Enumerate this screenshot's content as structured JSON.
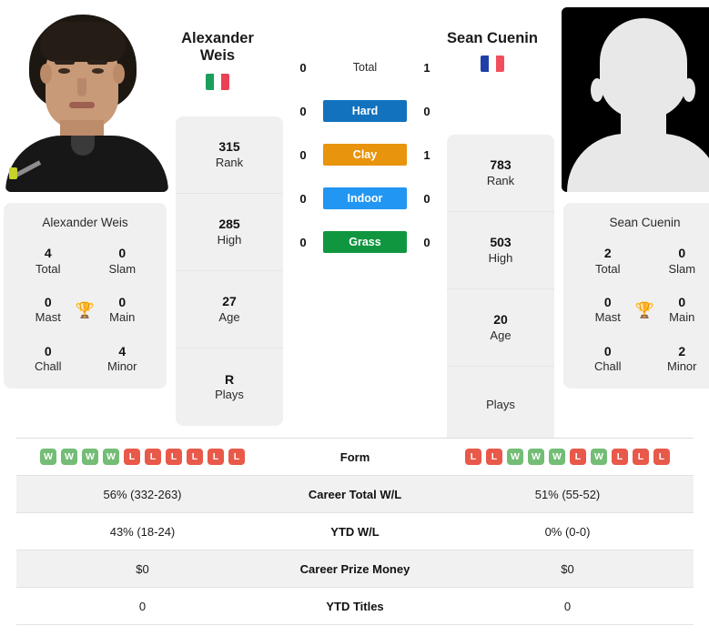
{
  "players": {
    "left": {
      "name": "Alexander Weis",
      "display_name_line1": "Alexander",
      "display_name_line2": "Weis",
      "country": "Italy",
      "flag_colors": [
        "#1aa05a",
        "#ffffff",
        "#ea4156"
      ],
      "photo_type": "portrait-photo",
      "titles": [
        {
          "value": "4",
          "label": "Total"
        },
        {
          "value": "0",
          "label": "Slam"
        },
        {
          "value": "0",
          "label": "Mast"
        },
        {
          "value": "0",
          "label": "Main"
        },
        {
          "value": "0",
          "label": "Chall"
        },
        {
          "value": "4",
          "label": "Minor"
        }
      ],
      "stats": [
        {
          "value": "315",
          "label": "Rank"
        },
        {
          "value": "285",
          "label": "High"
        },
        {
          "value": "27",
          "label": "Age"
        },
        {
          "value": "R",
          "label": "Plays"
        }
      ],
      "form": [
        "W",
        "W",
        "W",
        "W",
        "L",
        "L",
        "L",
        "L",
        "L",
        "L"
      ],
      "career_total_wl": "56% (332-263)",
      "ytd_wl": "43% (18-24)",
      "career_prize_money": "$0",
      "ytd_titles": "0"
    },
    "right": {
      "name": "Sean Cuenin",
      "display_name_line1": "Sean Cuenin",
      "display_name_line2": "",
      "country": "France",
      "flag_colors": [
        "#1f3fa8",
        "#ffffff",
        "#f0505e"
      ],
      "photo_type": "silhouette-placeholder",
      "titles": [
        {
          "value": "2",
          "label": "Total"
        },
        {
          "value": "0",
          "label": "Slam"
        },
        {
          "value": "0",
          "label": "Mast"
        },
        {
          "value": "0",
          "label": "Main"
        },
        {
          "value": "0",
          "label": "Chall"
        },
        {
          "value": "2",
          "label": "Minor"
        }
      ],
      "stats": [
        {
          "value": "783",
          "label": "Rank"
        },
        {
          "value": "503",
          "label": "High"
        },
        {
          "value": "20",
          "label": "Age"
        },
        {
          "value": "",
          "label": "Plays"
        }
      ],
      "form": [
        "L",
        "L",
        "W",
        "W",
        "W",
        "L",
        "W",
        "L",
        "L",
        "L"
      ],
      "career_total_wl": "51% (55-52)",
      "ytd_wl": "0% (0-0)",
      "career_prize_money": "$0",
      "ytd_titles": "0"
    }
  },
  "head_to_head": [
    {
      "left": "0",
      "label": "Total",
      "right": "1",
      "style": "plain",
      "color": ""
    },
    {
      "left": "0",
      "label": "Hard",
      "right": "0",
      "style": "badge",
      "color": "#1272bd"
    },
    {
      "left": "0",
      "label": "Clay",
      "right": "1",
      "style": "badge",
      "color": "#e8940c"
    },
    {
      "left": "0",
      "label": "Indoor",
      "right": "0",
      "style": "badge",
      "color": "#2196f3"
    },
    {
      "left": "0",
      "label": "Grass",
      "right": "0",
      "style": "badge",
      "color": "#119640"
    }
  ],
  "comparison_rows": [
    {
      "label": "Form",
      "type": "form",
      "shaded": false
    },
    {
      "label": "Career Total W/L",
      "type": "text",
      "shaded": true,
      "left": "56% (332-263)",
      "right": "51% (55-52)"
    },
    {
      "label": "YTD W/L",
      "type": "text",
      "shaded": false,
      "left": "43% (18-24)",
      "right": "0% (0-0)"
    },
    {
      "label": "Career Prize Money",
      "type": "text",
      "shaded": true,
      "left": "$0",
      "right": "$0"
    },
    {
      "label": "YTD Titles",
      "type": "text",
      "shaded": false,
      "left": "0",
      "right": "0"
    }
  ],
  "icons": {
    "trophy": "🏆"
  },
  "colors": {
    "win": "#74bd76",
    "loss": "#e8594a",
    "card_bg": "#f0f0f0",
    "row_shaded": "#f1f1f1"
  }
}
